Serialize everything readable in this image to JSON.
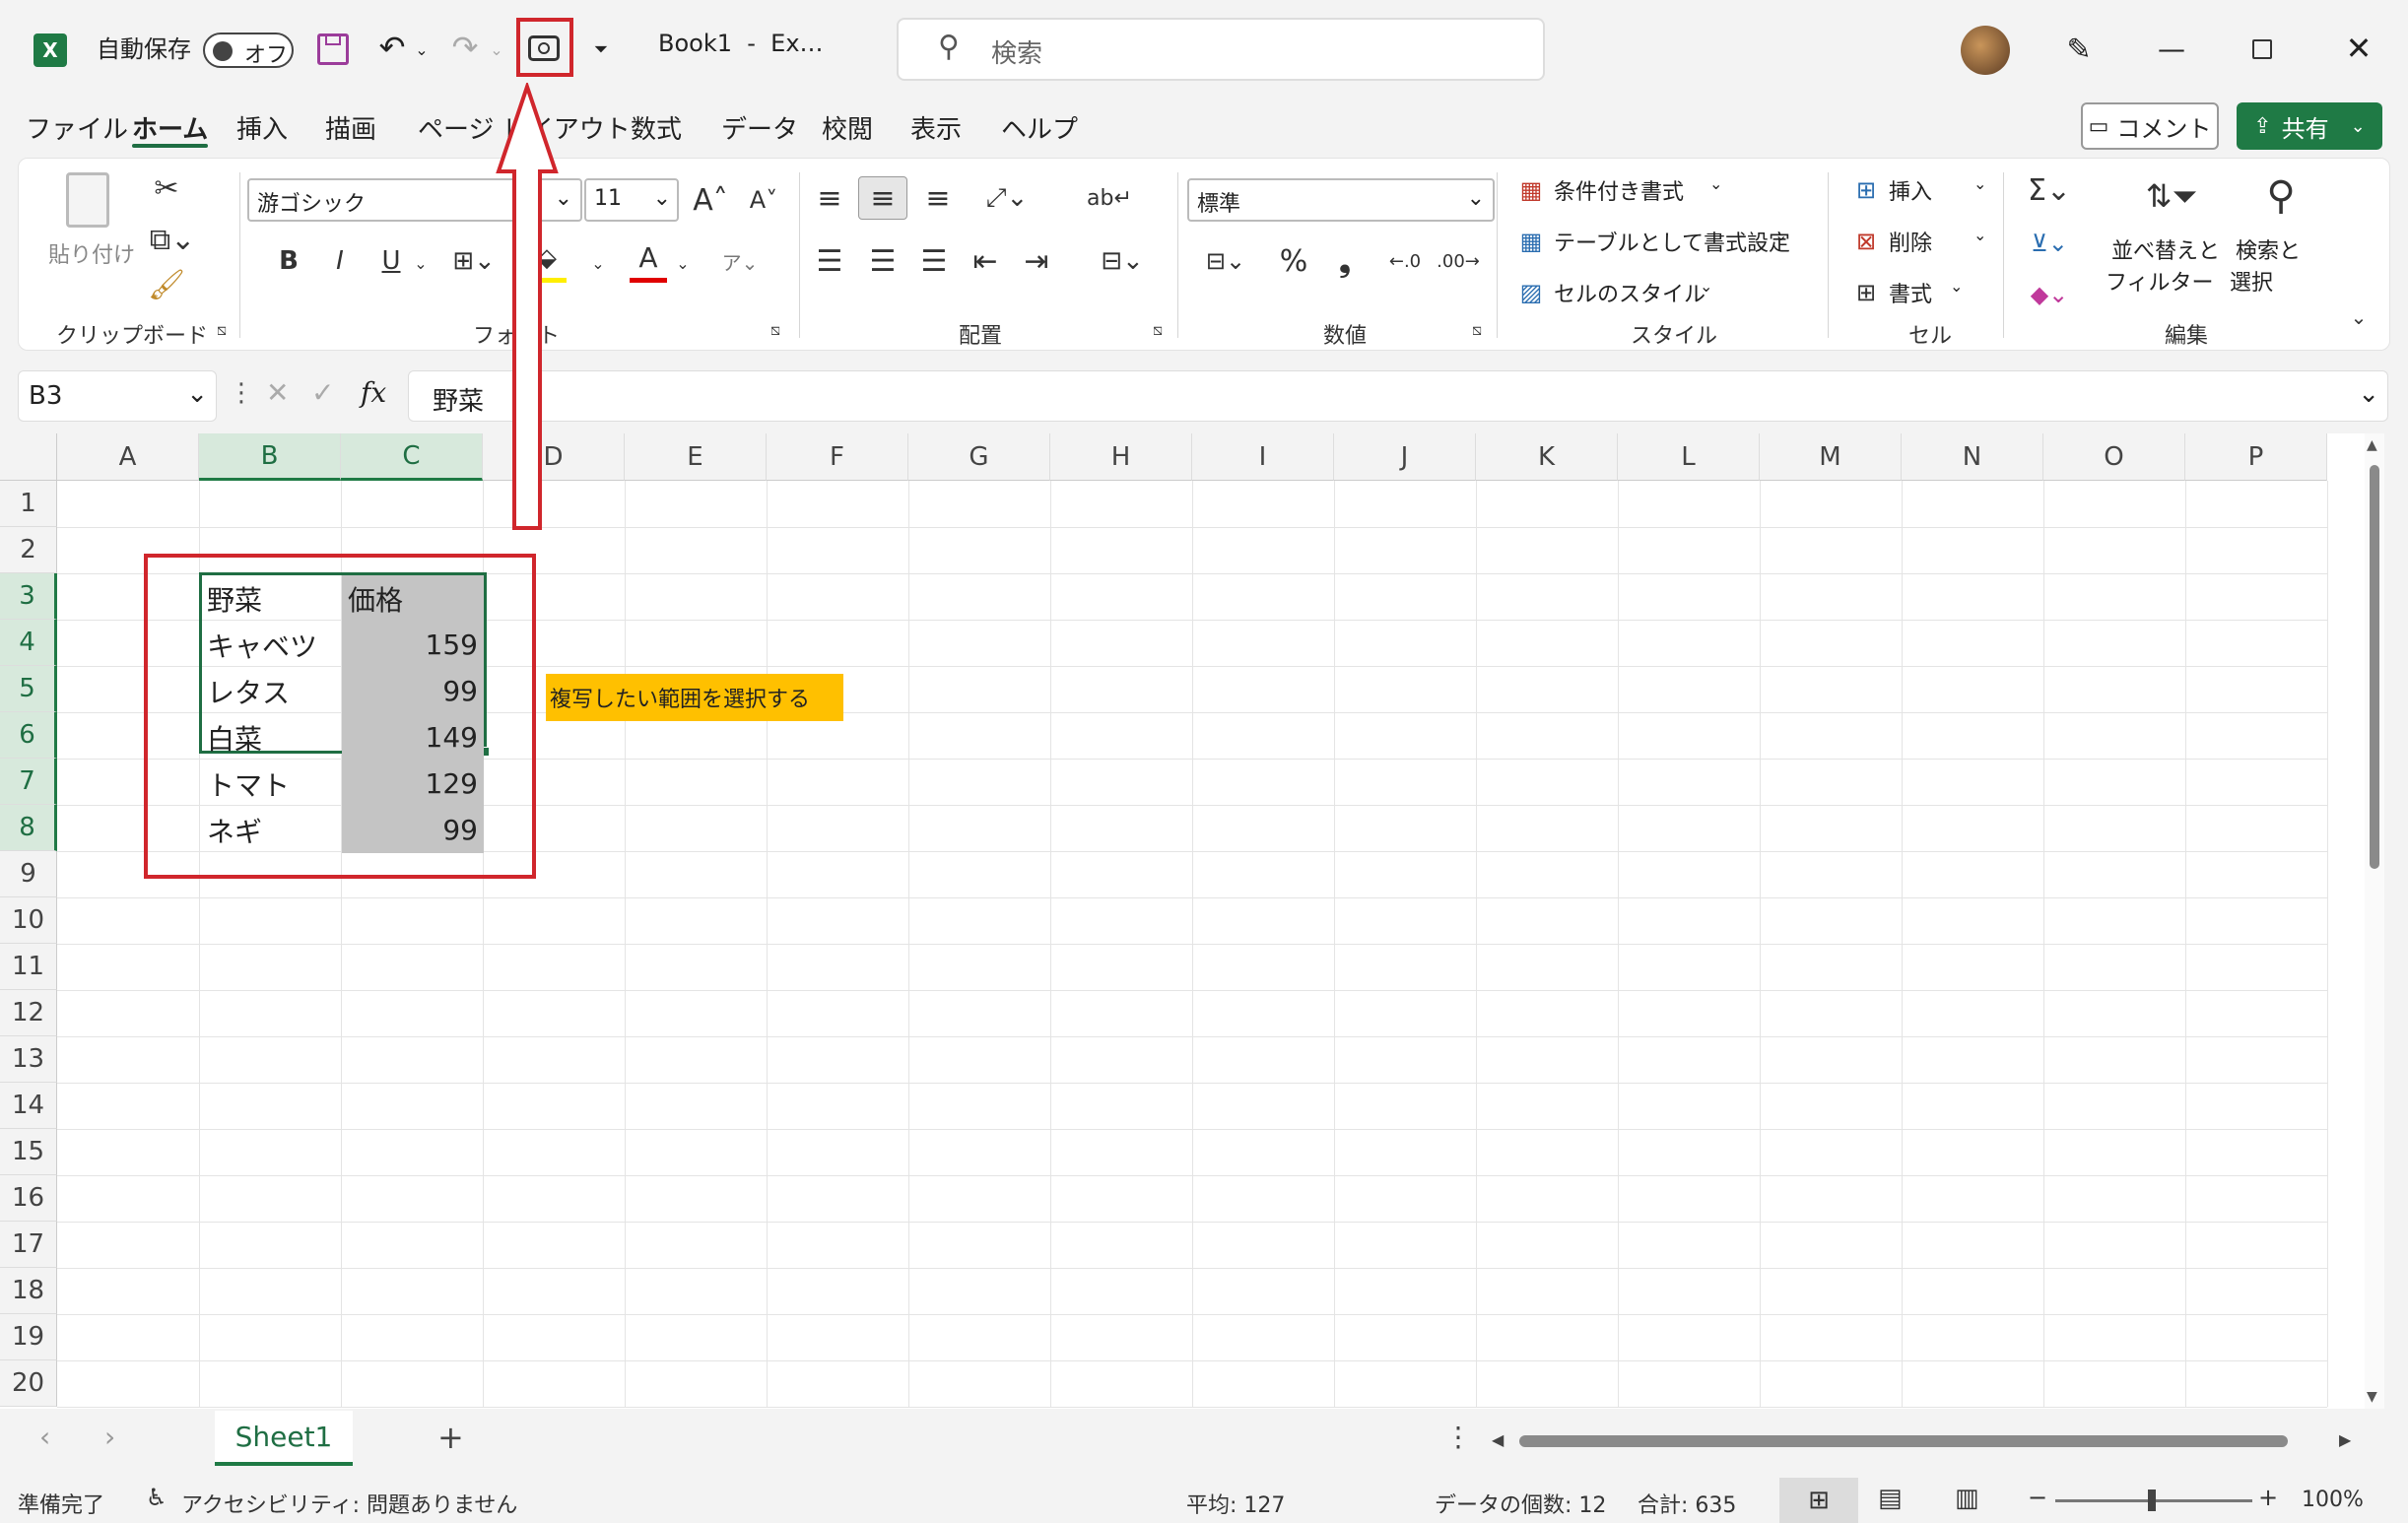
{
  "titlebar": {
    "autosave_label": "自動保存",
    "autosave_state": "オフ",
    "doc_title": "Book1  -  Ex…",
    "search_placeholder": "検索"
  },
  "tabs": [
    "ファイル",
    "ホーム",
    "挿入",
    "描画",
    "ページ レイアウト",
    "数式",
    "データ",
    "校閲",
    "表示",
    "ヘルプ"
  ],
  "actions": {
    "comment": "コメント",
    "share": "共有"
  },
  "ribbon": {
    "clipboard": {
      "paste": "貼り付け",
      "label": "クリップボード"
    },
    "font": {
      "family": "游ゴシック",
      "size": "11",
      "bold": "B",
      "italic": "I",
      "underline": "U",
      "label": "フォント"
    },
    "alignment": {
      "label": "配置"
    },
    "number": {
      "format": "標準",
      "percent": "%",
      "comma": "❟",
      "label": "数値"
    },
    "styles": {
      "conditional": "条件付き書式",
      "table": "テーブルとして書式設定",
      "cell_styles": "セルのスタイル",
      "label": "スタイル"
    },
    "cells": {
      "insert": "挿入",
      "delete": "削除",
      "format": "書式",
      "label": "セル"
    },
    "editing": {
      "sort_line1": "並べ替えと",
      "sort_line2": "フィルター",
      "find_line1": "検索と",
      "find_line2": "選択",
      "label": "編集"
    }
  },
  "formula_bar": {
    "name_box": "B3",
    "fx": "fx",
    "content": "野菜"
  },
  "columns": [
    "A",
    "B",
    "C",
    "D",
    "E",
    "F",
    "G",
    "H",
    "I",
    "J",
    "K",
    "L",
    "M",
    "N",
    "O",
    "P"
  ],
  "rows": [
    "1",
    "2",
    "3",
    "4",
    "5",
    "6",
    "7",
    "8",
    "9",
    "10",
    "11",
    "12",
    "13",
    "14",
    "15",
    "16",
    "17",
    "18",
    "19",
    "20"
  ],
  "table": {
    "header": [
      "野菜",
      "価格"
    ],
    "data": [
      [
        "キャベツ",
        "159"
      ],
      [
        "レタス",
        "99"
      ],
      [
        "白菜",
        "149"
      ],
      [
        "トマト",
        "129"
      ],
      [
        "ネギ",
        "99"
      ]
    ]
  },
  "annotation": {
    "note": "複写したい範囲を選択する",
    "note_color": "#ffc000",
    "highlight_color": "#d0262c"
  },
  "sheets": [
    "Sheet1"
  ],
  "status": {
    "ready": "準備完了",
    "accessibility": "アクセシビリティ: 問題ありません",
    "average": "平均: 127",
    "count": "データの個数: 12",
    "sum": "合計: 635",
    "zoom": "100%"
  }
}
